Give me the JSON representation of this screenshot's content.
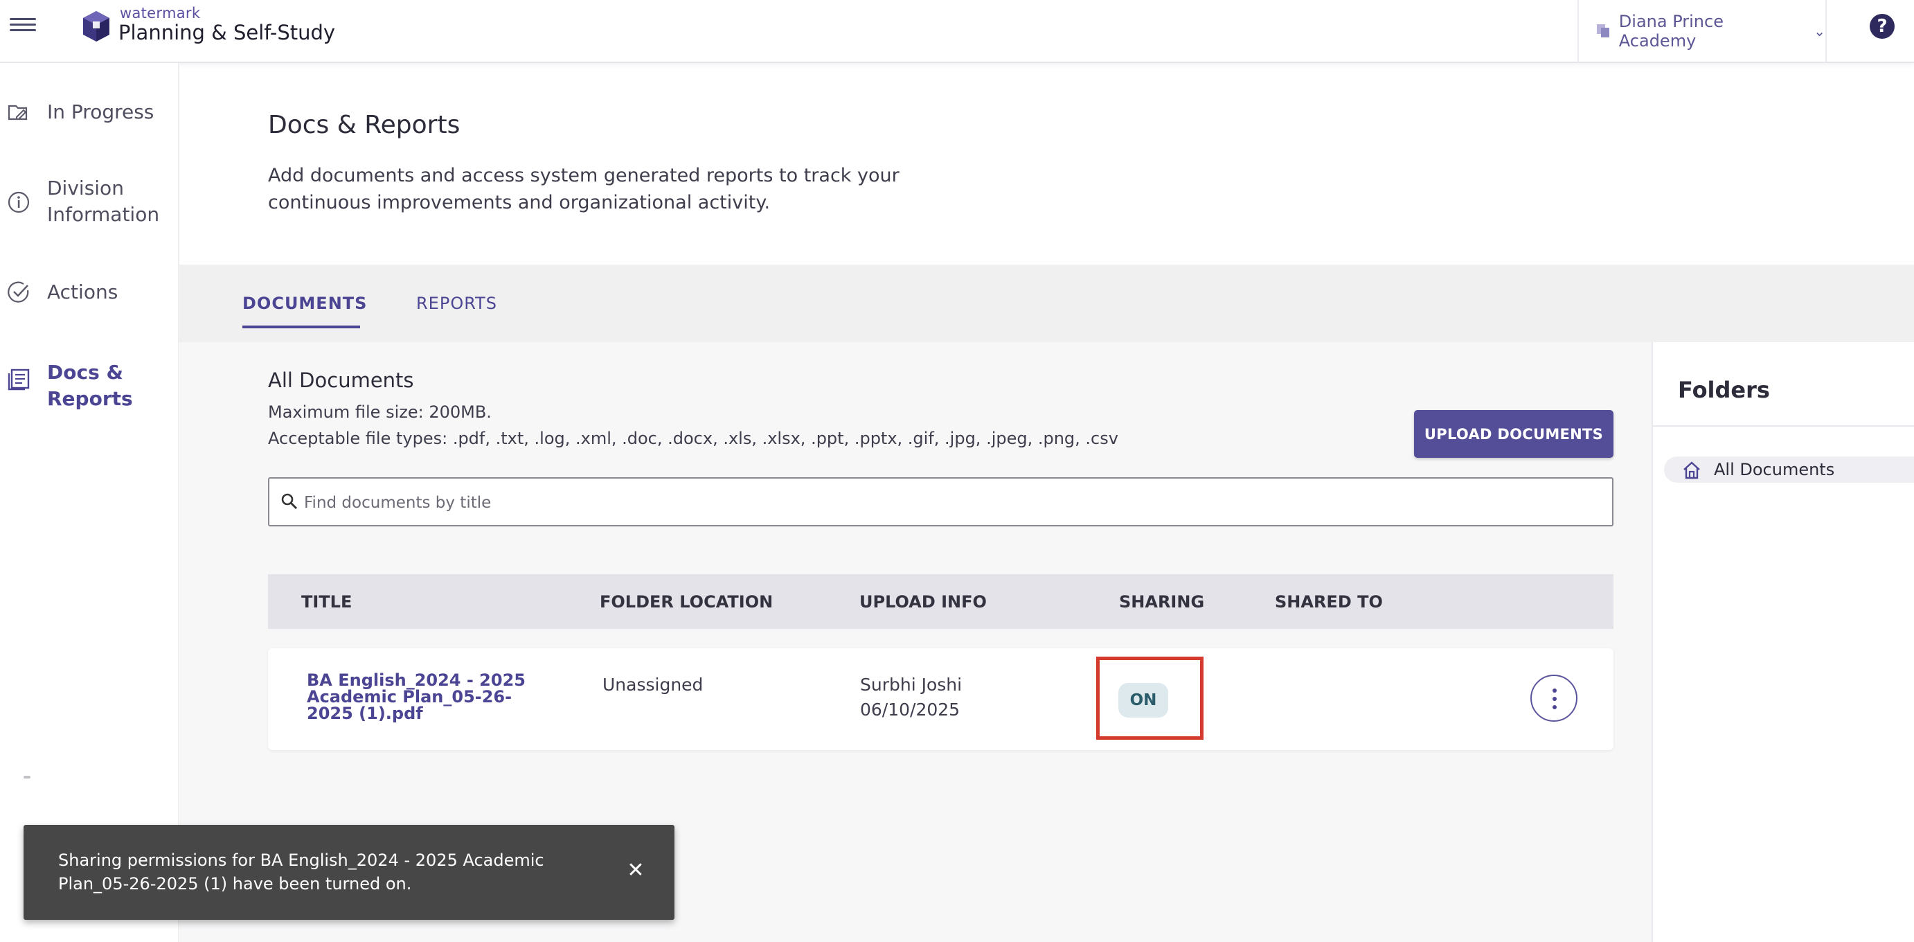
{
  "header": {
    "logo_small": "watermark",
    "app_title": "Planning & Self-Study",
    "org_name": "Diana Prince Academy",
    "help_label": "?",
    "brand_color": "#4b4593"
  },
  "sidebar": {
    "items": [
      {
        "label": "In Progress",
        "icon": "in-progress-icon",
        "active": false
      },
      {
        "label": "Division Information",
        "icon": "info-icon",
        "active": false
      },
      {
        "label": "Actions",
        "icon": "check-circle-icon",
        "active": false
      },
      {
        "label": "Docs & Reports",
        "icon": "docs-reports-icon",
        "active": true
      }
    ]
  },
  "page": {
    "title": "Docs & Reports",
    "description": "Add documents and access system generated reports to track your continuous improvements and organizational activity."
  },
  "tabs": [
    {
      "label": "DOCUMENTS",
      "active": true
    },
    {
      "label": "REPORTS",
      "active": false
    }
  ],
  "documents": {
    "heading": "All Documents",
    "max_size": "Maximum file size: 200MB.",
    "file_types": "Acceptable file types: .pdf, .txt, .log, .xml, .doc, .docx, .xls, .xlsx, .ppt, .pptx, .gif, .jpg, .jpeg, .png, .csv",
    "upload_label": "UPLOAD DOCUMENTS",
    "search_placeholder": "Find documents by title",
    "columns": [
      "TITLE",
      "FOLDER LOCATION",
      "UPLOAD INFO",
      "SHARING",
      "SHARED TO"
    ],
    "rows": [
      {
        "title": "BA English_2024 - 2025 Academic Plan_05-26-2025 (1).pdf",
        "folder": "Unassigned",
        "uploader": "Surbhi Joshi",
        "upload_date": "06/10/2025",
        "sharing": "ON",
        "shared_to": ""
      }
    ]
  },
  "folders": {
    "title": "Folders",
    "items": [
      {
        "label": "All Documents",
        "icon": "home-icon"
      }
    ]
  },
  "toast": {
    "message": "Sharing permissions for BA English_2024 - 2025 Academic Plan_05-26-2025 (1) have been turned on.",
    "close_label": "✕"
  }
}
